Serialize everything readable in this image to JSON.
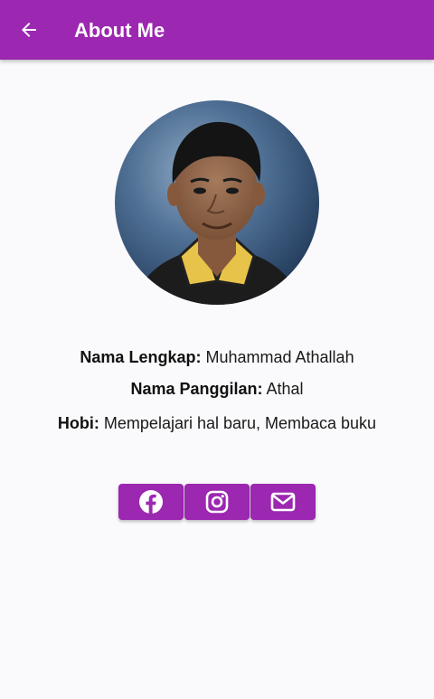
{
  "appbar": {
    "title": "About Me",
    "back_icon": "arrow-left-icon",
    "color": "#9c27b0"
  },
  "profile": {
    "photo_alt": "profile photo"
  },
  "info": {
    "full_name_label": "Nama Lengkap:",
    "full_name_value": "Muhammad Athallah",
    "nickname_label": "Nama Panggilan:",
    "nickname_value": "Athal",
    "hobby_label": "Hobi:",
    "hobby_value": "Mempelajari hal baru, Membaca buku"
  },
  "social": [
    {
      "icon": "facebook-icon"
    },
    {
      "icon": "instagram-icon"
    },
    {
      "icon": "email-icon"
    }
  ]
}
